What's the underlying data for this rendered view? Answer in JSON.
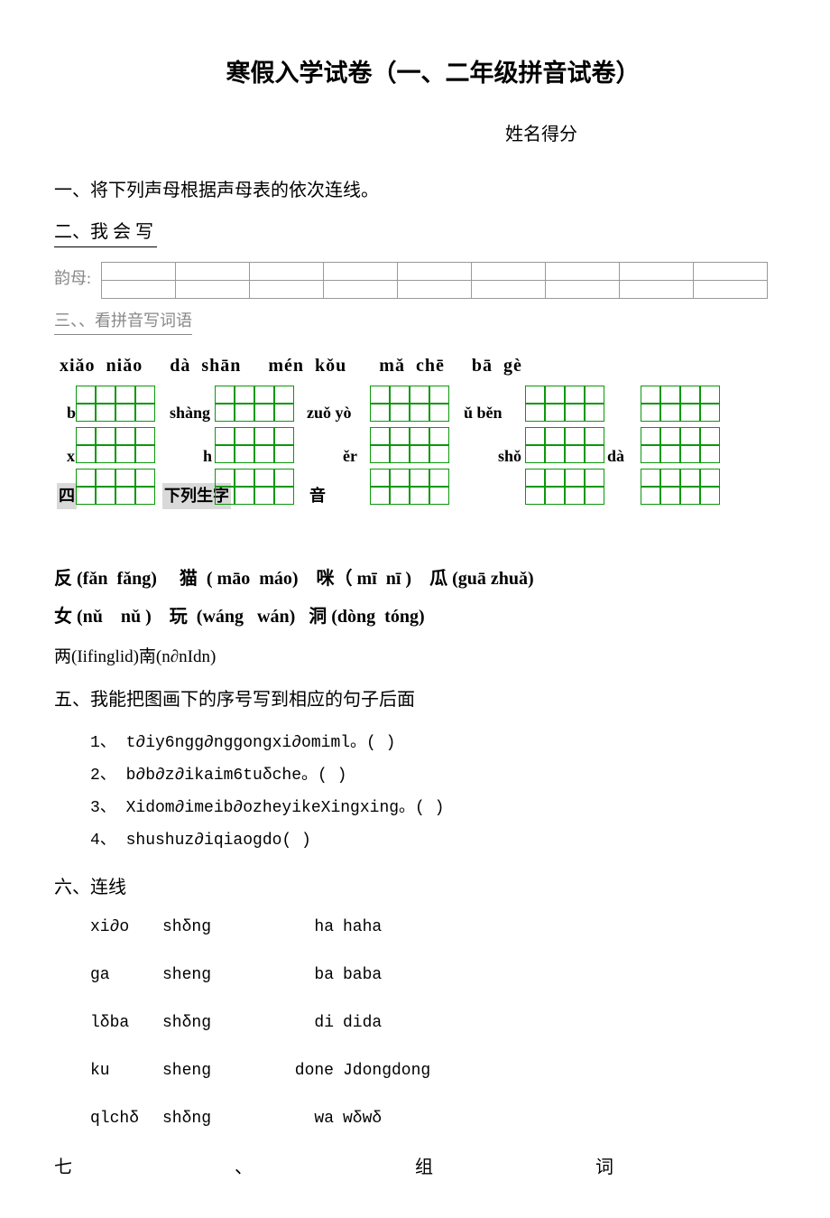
{
  "title": "寒假入学试卷（一、二年级拼音试卷）",
  "name_score": "姓名得分",
  "section1": "一、将下列声母根据声母表的依次连线。",
  "section2": "二、我 会 写",
  "yunmu_label": "韵母:",
  "section3": "三、、看拼音写词语",
  "pinyin_row1": " xiǎo  niǎo     dà  shān     mén  kǒu      mǎ  chē     bā  gè",
  "side": {
    "s1": "b",
    "s2": "shàng",
    "s3": "zuǒ  yò",
    "s4": "ǔ  běn",
    "s5": "x",
    "s6": "h",
    "s7": "ěr",
    "s8": "shǒ",
    "s9": "dà",
    "s10": "四",
    "s11": "下列生字",
    "s12": "音"
  },
  "q4_line1": "反 (fǎn  fǎng)     猫  ( māo  máo)    咪（ mī  nī )    瓜 (guā zhuǎ)",
  "q4_line2": "女 (nǔ    nǔ )    玩  (wáng   wán)   洞 (dòng  tóng)",
  "q_two": "两(Iifinglid)南(n∂nIdn)",
  "q5": "五、我能把图画下的序号写到相应的句子后面",
  "list": {
    "l1": "1、 t∂iy6ngg∂nggongxi∂omiml。(          )",
    "l2": "2、 b∂b∂z∂ikaim6tuδche。(          )",
    "l3": "3、 Xidom∂imeib∂ozheyikeXingxing。(            )",
    "l4": "4、 shushuz∂iqiaogdo(         )"
  },
  "q6": "六、连线",
  "match": [
    {
      "a": "xi∂o",
      "b": "shδng",
      "c": "ha",
      "d": "haha"
    },
    {
      "a": "ga",
      "b": "sheng",
      "c": "ba",
      "d": "baba"
    },
    {
      "a": "lδba",
      "b": "shδng",
      "c": "di",
      "d": "dida"
    },
    {
      "a": "ku",
      "b": "sheng",
      "c": "done",
      "d": "Jdongdong"
    },
    {
      "a": "qlchδ",
      "b": "shδng",
      "c": "wa",
      "d": "wδwδ"
    }
  ],
  "q7": {
    "a": "七",
    "b": "、",
    "c": "组",
    "d": "词"
  }
}
